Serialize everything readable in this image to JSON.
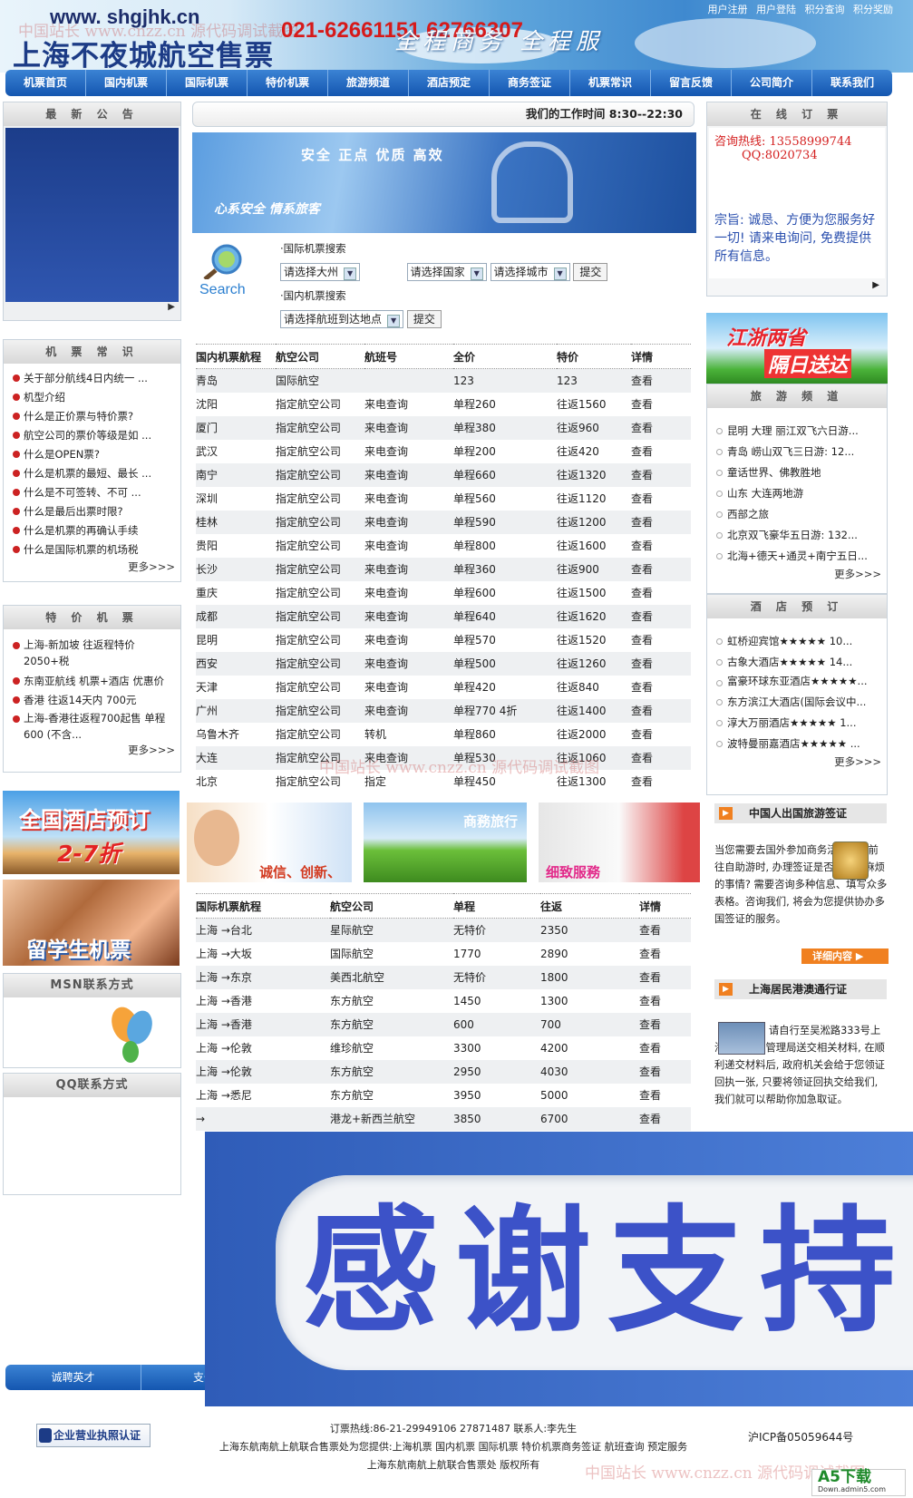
{
  "header": {
    "url": "www. shgjhk.cn",
    "title": "上海不夜城航空售票",
    "phone": "021-62661151 62766307",
    "slogan": "全程商务 全程服",
    "toplinks": [
      "用户注册",
      "用户登陆",
      "积分查询",
      "积分奖励"
    ],
    "watermark": "中国站长 www.cnzz.cn 源代码调试截图"
  },
  "nav": [
    "机票首页",
    "国内机票",
    "国际机票",
    "特价机票",
    "旅游频道",
    "酒店预定",
    "商务签证",
    "机票常识",
    "留言反馈",
    "公司简介",
    "联系我们"
  ],
  "notice": {
    "title": "最 新 公 告"
  },
  "worktime": "我们的工作时间 8:30--22:30",
  "banner": {
    "line1": "安全 正点 优质 高效",
    "line2": "心系安全 情系旅客"
  },
  "search": {
    "icon_label": "Search",
    "intl_label": "·国际机票搜索",
    "continent": "请选择大州",
    "country": "请选择国家",
    "city": "请选择城市",
    "submit": "提交",
    "domestic_label": "·国内机票搜索",
    "route": "请选择航班到达地点",
    "submit2": "提交"
  },
  "online": {
    "title": "在 线 订 票",
    "hotline": "咨询热线: 13558999744",
    "qq": "QQ:8020734",
    "motto": "宗旨: 诚恳、方便为您服务好一切! 请来电询问, 免费提供所有信息。"
  },
  "knowledge": {
    "title": "机 票 常 识",
    "items": [
      "关于部分航线4日内统一 ...",
      "机型介绍",
      "什么是正价票与特价票?",
      "航空公司的票价等级是如 ...",
      "什么是OPEN票?",
      "什么是机票的最短、最长 ...",
      "什么是不可签转、不可 ...",
      "什么是最后出票时限?",
      "什么是机票的再确认手续",
      "什么是国际机票的机场税"
    ],
    "more": "更多>>>"
  },
  "special": {
    "title": "特 价 机 票",
    "items": [
      "上海-新加坡 往返程特价2050+税",
      "东南亚航线 机票+酒店 优惠价",
      "香港 往返14天内 700元",
      "上海-香港往返程700起售 单程600 (不含..."
    ],
    "more": "更多>>>"
  },
  "ads": {
    "hotel1": "全国酒店预订",
    "hotel2": "2-7折",
    "student": "留学生机票"
  },
  "msn": {
    "title": "MSN联系方式"
  },
  "qq": {
    "title": "QQ联系方式"
  },
  "domestic": {
    "headers": [
      "国内机票航程",
      "航空公司",
      "航班号",
      "全价",
      "特价",
      "详情"
    ],
    "rows": [
      [
        "青岛",
        "国际航空",
        "",
        "123",
        "123",
        "查看"
      ],
      [
        "沈阳",
        "指定航空公司",
        "来电查询",
        "单程260",
        "往返1560",
        "查看"
      ],
      [
        "厦门",
        "指定航空公司",
        "来电查询",
        "单程380",
        "往返960",
        "查看"
      ],
      [
        "武汉",
        "指定航空公司",
        "来电查询",
        "单程200",
        "往返420",
        "查看"
      ],
      [
        "南宁",
        "指定航空公司",
        "来电查询",
        "单程660",
        "往返1320",
        "查看"
      ],
      [
        "深圳",
        "指定航空公司",
        "来电查询",
        "单程560",
        "往返1120",
        "查看"
      ],
      [
        "桂林",
        "指定航空公司",
        "来电查询",
        "单程590",
        "往返1200",
        "查看"
      ],
      [
        "贵阳",
        "指定航空公司",
        "来电查询",
        "单程800",
        "往返1600",
        "查看"
      ],
      [
        "长沙",
        "指定航空公司",
        "来电查询",
        "单程360",
        "往返900",
        "查看"
      ],
      [
        "重庆",
        "指定航空公司",
        "来电查询",
        "单程600",
        "往返1500",
        "查看"
      ],
      [
        "成都",
        "指定航空公司",
        "来电查询",
        "单程640",
        "往返1620",
        "查看"
      ],
      [
        "昆明",
        "指定航空公司",
        "来电查询",
        "单程570",
        "往返1520",
        "查看"
      ],
      [
        "西安",
        "指定航空公司",
        "来电查询",
        "单程500",
        "往返1260",
        "查看"
      ],
      [
        "天津",
        "指定航空公司",
        "来电查询",
        "单程420",
        "往返840",
        "查看"
      ],
      [
        "广州",
        "指定航空公司",
        "来电查询",
        "单程770 4折",
        "往返1400",
        "查看"
      ],
      [
        "乌鲁木齐",
        "指定航空公司",
        "转机",
        "单程860",
        "往返2000",
        "查看"
      ],
      [
        "大连",
        "指定航空公司",
        "来电查询",
        "单程530",
        "往返1060",
        "查看"
      ],
      [
        "北京",
        "指定航空公司",
        "指定",
        "单程450",
        "往返1300",
        "查看"
      ]
    ]
  },
  "promo": {
    "p1": "诚信、创新、",
    "p2": "商務旅行",
    "p3": "细致服務"
  },
  "international": {
    "headers": [
      "国际机票航程",
      "航空公司",
      "单程",
      "往返",
      "详情"
    ],
    "rows": [
      [
        "上海 →台北",
        "星际航空",
        "无特价",
        "2350",
        "查看"
      ],
      [
        "上海 →大坂",
        "国际航空",
        "1770",
        "2890",
        "查看"
      ],
      [
        "上海 →东京",
        "美西北航空",
        "无特价",
        "1800",
        "查看"
      ],
      [
        "上海 →香港",
        "东方航空",
        "1450",
        "1300",
        "查看"
      ],
      [
        "上海 →香港",
        "东方航空",
        "600",
        "700",
        "查看"
      ],
      [
        "上海 →伦敦",
        "维珍航空",
        "3300",
        "4200",
        "查看"
      ],
      [
        "上海 →伦敦",
        "东方航空",
        "2950",
        "4030",
        "查看"
      ],
      [
        "上海 →悉尼",
        "东方航空",
        "3950",
        "5000",
        "查看"
      ],
      [
        "→",
        "港龙+新西兰航空",
        "3850",
        "6700",
        "查看"
      ]
    ]
  },
  "travel_ad": {
    "line1": "江浙两省",
    "line2": "隔日送达"
  },
  "travel": {
    "title": "旅 游 频 道",
    "items": [
      "昆明 大理 丽江双飞六日游...",
      "青岛 崂山双飞三日游: 12...",
      "童话世界、佛教胜地",
      "山东 大连两地游",
      "西部之旅",
      "北京双飞豪华五日游: 132...",
      "北海+德天+通灵+南宁五日..."
    ],
    "more": "更多>>>"
  },
  "hotel": {
    "title": "酒 店 预 订",
    "items": [
      "虹桥迎宾馆★★★★★ 10...",
      "古象大酒店★★★★★ 14...",
      "富豪环球东亚酒店★★★★★...",
      "东方滨江大酒店(国际会议中...",
      "淳大万丽酒店★★★★★ 1...",
      "波特曼丽嘉酒店★★★★★ ..."
    ],
    "more": "更多>>>"
  },
  "visa": {
    "title": "中国人出国旅游签证",
    "text": "当您需要去国外参加商务活动或者前往自助游时, 办理签证是否一件很麻烦的事情? 需要咨询多种信息、填写众多表格。咨询我们, 将会为您提供协办多国签证的服务。",
    "button": "详细内容"
  },
  "hk": {
    "title": "上海居民港澳通行证",
    "text": "请自行至吴淞路333号上海市出入境管理局送交相关材料, 在顺利递交材料后, 政府机关会给于您领证回执一张, 只要将领证回执交给我们, 我们就可以帮助你加急取证。"
  },
  "overlay": {
    "text": "感谢支持"
  },
  "footer": {
    "nav": [
      "诚聘英才",
      "支付方"
    ],
    "badge": "企业营业执照认证",
    "hotline": "订票热线:86-21-29949106 27871487 联系人:李先生",
    "links": "上海东航南航上航联合售票处为您提供:上海机票 国内机票 国际机票 特价机票商务签证 航班查询 预定服务",
    "copyright": "上海东航南航上航联合售票处 版权所有",
    "icp": "沪ICP备05059644号",
    "logo": "A5下载",
    "logo_sub": "Down.admin5.com"
  }
}
